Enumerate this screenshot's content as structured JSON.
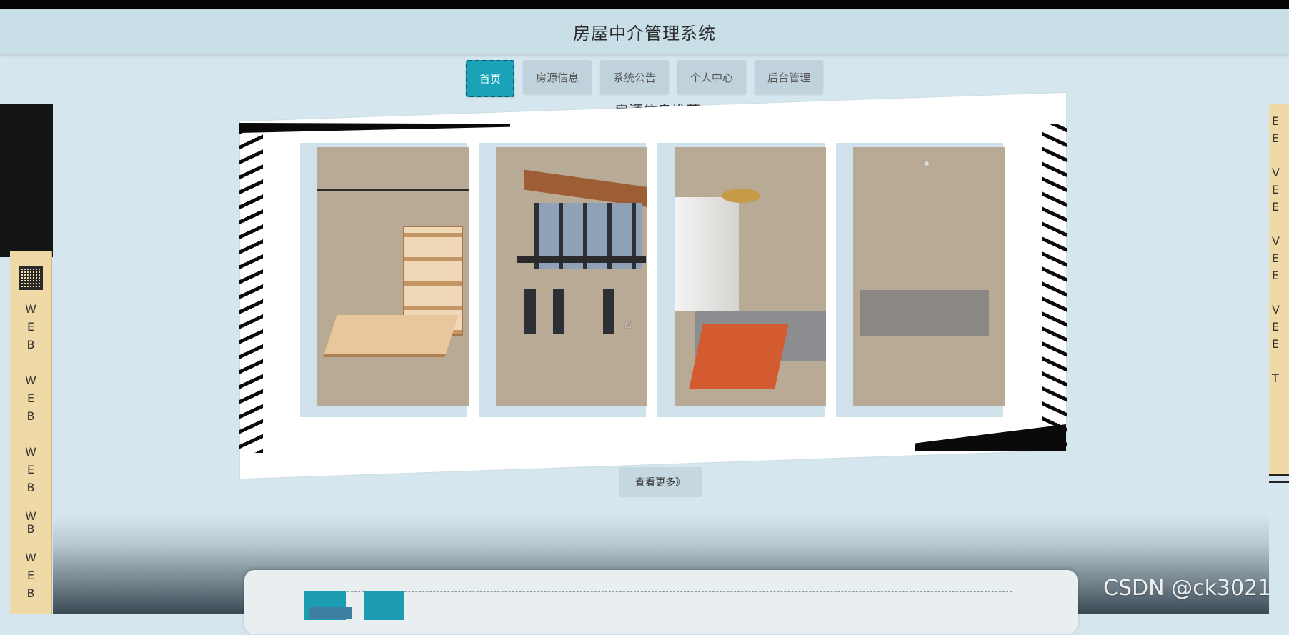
{
  "header": {
    "title": "房屋中介管理系统"
  },
  "nav": {
    "items": [
      {
        "label": "首页"
      },
      {
        "label": "房源信息"
      },
      {
        "label": "系统公告"
      },
      {
        "label": "个人中心"
      },
      {
        "label": "后台管理"
      }
    ]
  },
  "section": {
    "title": "房源信息推荐"
  },
  "sidebar": {
    "left_labels": [
      "W",
      "E",
      "B",
      "W",
      "E",
      "B",
      "W",
      "E",
      "B",
      "W",
      "B",
      "W",
      "E",
      "B"
    ],
    "right_labels": [
      "E",
      "E",
      "V",
      "E",
      "E",
      "V",
      "E",
      "E",
      "V",
      "E",
      "E",
      "T"
    ]
  },
  "actions": {
    "more_label": "查看更多》"
  },
  "watermark": {
    "text": "CSDN @ck3021"
  }
}
